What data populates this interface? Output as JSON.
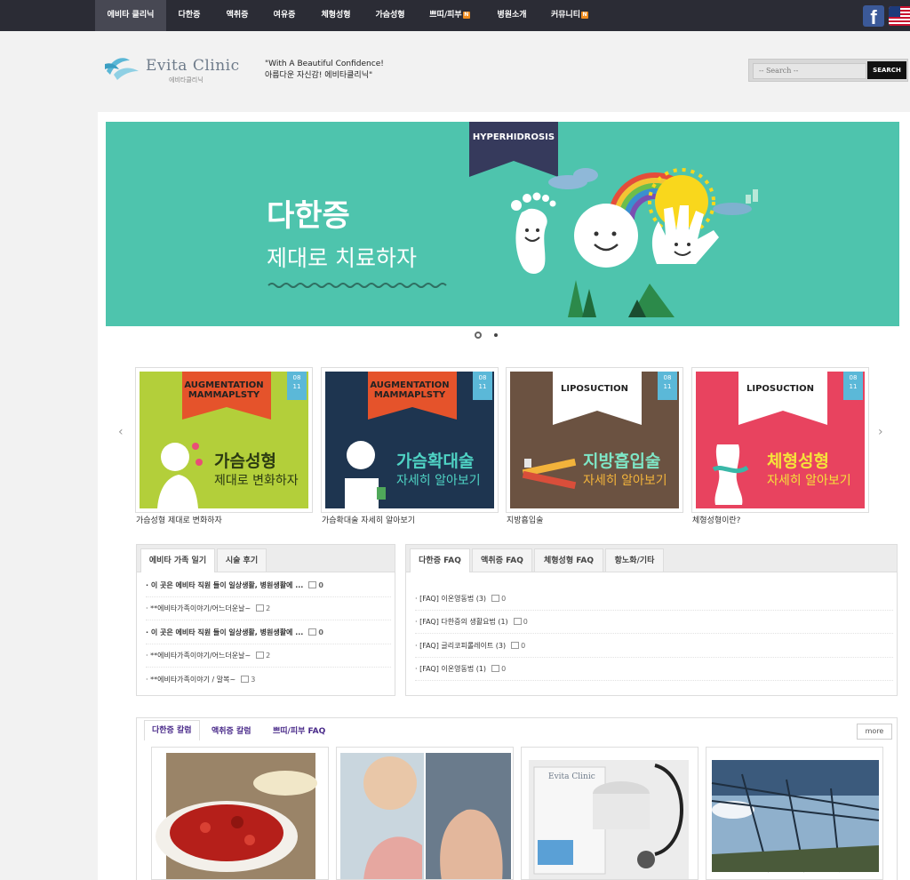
{
  "nav": {
    "items": [
      {
        "label": "에비타 클리닉",
        "new": false,
        "active": true
      },
      {
        "label": "다한증",
        "new": false,
        "active": false
      },
      {
        "label": "액취증",
        "new": false,
        "active": false
      },
      {
        "label": "여유증",
        "new": false,
        "active": false
      },
      {
        "label": "체형성형",
        "new": false,
        "active": false
      },
      {
        "label": "가슴성형",
        "new": false,
        "active": false
      },
      {
        "label": "쁘띠/피부",
        "new": true,
        "active": false
      },
      {
        "label": "병원소개",
        "new": false,
        "active": false
      },
      {
        "label": "커뮤니티",
        "new": true,
        "active": false
      }
    ],
    "new_badge": "N",
    "facebook_icon": "f"
  },
  "header": {
    "logo_text": "Evita Clinic",
    "logo_sub": "에비타클리닉",
    "slogan_line1": "\"With A Beautiful Confidence!",
    "slogan_line2": "아름다운 자신감! 에비타클리닉\"",
    "search_placeholder": "-- Search --",
    "search_button": "SEARCH"
  },
  "banner": {
    "ribbon": "HYPERHIDROSIS",
    "title": "다한증",
    "subtitle": "제대로 치료하자",
    "bg_color": "#4ec4ad"
  },
  "cards": [
    {
      "ribbon": "AUGMENTATION\nMAMMAPLSTY",
      "date": "08\n11",
      "title": "가슴성형",
      "sub": "제대로 변화하자",
      "caption": "가슴성형 제대로 변화하자",
      "bg": "#b3cf3a",
      "title_color": "#2b3a12",
      "sub_color": "#2b3a12"
    },
    {
      "ribbon": "AUGMENTATION\nMAMMAPLSTY",
      "date": "08\n11",
      "title": "가슴확대술",
      "sub": "자세히 알아보기",
      "caption": "가슴확대술 자세히 알아보기",
      "bg": "#1e3550",
      "title_color": "#4fd3c4",
      "sub_color": "#4fd3c4"
    },
    {
      "ribbon": "LIPOSUCTION",
      "date": "08\n11",
      "title": "지방흡입술",
      "sub": "자세히 알아보기",
      "caption": "지방흡입술",
      "bg": "#6b5241",
      "title_color": "#7ee6c6",
      "sub_color": "#f2b33b"
    },
    {
      "ribbon": "LIPOSUCTION",
      "date": "08\n11",
      "title": "체형성형",
      "sub": "자세히 알아보기",
      "caption": "체형성형이란?",
      "bg": "#e8435f",
      "title_color": "#f5e33a",
      "sub_color": "#f5e33a"
    }
  ],
  "left_box": {
    "tabs": [
      "에비타 가족 일기",
      "시술 후기"
    ],
    "rows": [
      {
        "title": "이 곳은 에비타 직원 들이 일상생활, 병원생활에 ...",
        "count": "0",
        "bold": true
      },
      {
        "title": "**에비타가족이야기/어느더운날~",
        "count": "2",
        "bold": false
      },
      {
        "title": "이 곳은 에비타 직원 들이 일상생활, 병원생활에 ...",
        "count": "0",
        "bold": true
      },
      {
        "title": "**에비타가족이야기/어느더운날~",
        "count": "2",
        "bold": false
      },
      {
        "title": "**에비타가족이야기 / 말복~",
        "count": "3",
        "bold": false
      }
    ]
  },
  "right_box": {
    "tabs": [
      "다한증 FAQ",
      "액취증 FAQ",
      "체형성형 FAQ",
      "항노화/기타"
    ],
    "rows": [
      {
        "title": "[FAQ] 이온영동법 (3)",
        "count": "0"
      },
      {
        "title": "[FAQ] 다한증의 생활요법 (1)",
        "count": "0"
      },
      {
        "title": "[FAQ] 글리코피롤레이트 (3)",
        "count": "0"
      },
      {
        "title": "[FAQ] 이온영동법 (1)",
        "count": "0"
      }
    ]
  },
  "columns": {
    "tabs": [
      "다한증 칼럼",
      "액취증 칼럼",
      "쁘띠/피부 FAQ"
    ],
    "more": "more",
    "thumb_logo": "Evita Clinic"
  }
}
